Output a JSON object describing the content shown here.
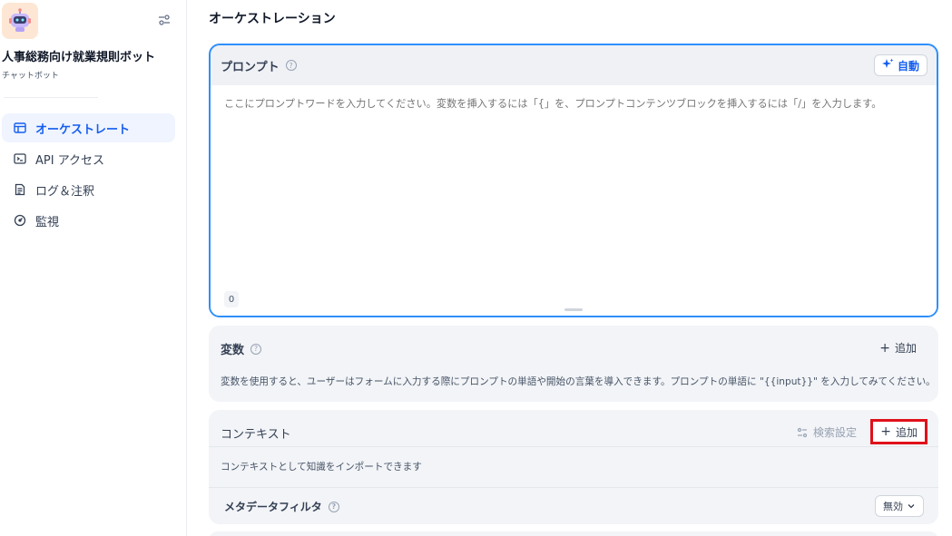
{
  "sidebar": {
    "app_name": "人事総務向け就業規則ボット",
    "app_type": "チャットボット",
    "nav": [
      {
        "label": "オーケストレート",
        "icon": "window-icon",
        "active": true
      },
      {
        "label": "API アクセス",
        "icon": "terminal-icon",
        "active": false
      },
      {
        "label": "ログ＆注釈",
        "icon": "document-list-icon",
        "active": false
      },
      {
        "label": "監視",
        "icon": "gauge-icon",
        "active": false
      }
    ]
  },
  "main": {
    "title": "オーケストレーション",
    "prompt": {
      "title": "プロンプト",
      "auto_label": "自動",
      "placeholder": "ここにプロンプトワードを入力してください。変数を挿入するには「{」を、プロンプトコンテンツブロックを挿入するには「/」を入力します。",
      "char_count": "0"
    },
    "variables": {
      "title": "変数",
      "add_label": "追加",
      "description": "変数を使用すると、ユーザーはフォームに入力する際にプロンプトの単語や開始の言葉を導入できます。プロンプトの単語に \"{{input}}\" を入力してみてください。"
    },
    "context": {
      "title": "コンテキスト",
      "search_settings_label": "検索設定",
      "add_label": "追加",
      "description": "コンテキストとして知識をインポートできます",
      "metadata_filter_label": "メタデータフィルタ",
      "metadata_filter_value": "無効"
    }
  },
  "colors": {
    "accent": "#155eef",
    "highlight_border": "#e0111b",
    "focus_border": "#2e90fa"
  }
}
